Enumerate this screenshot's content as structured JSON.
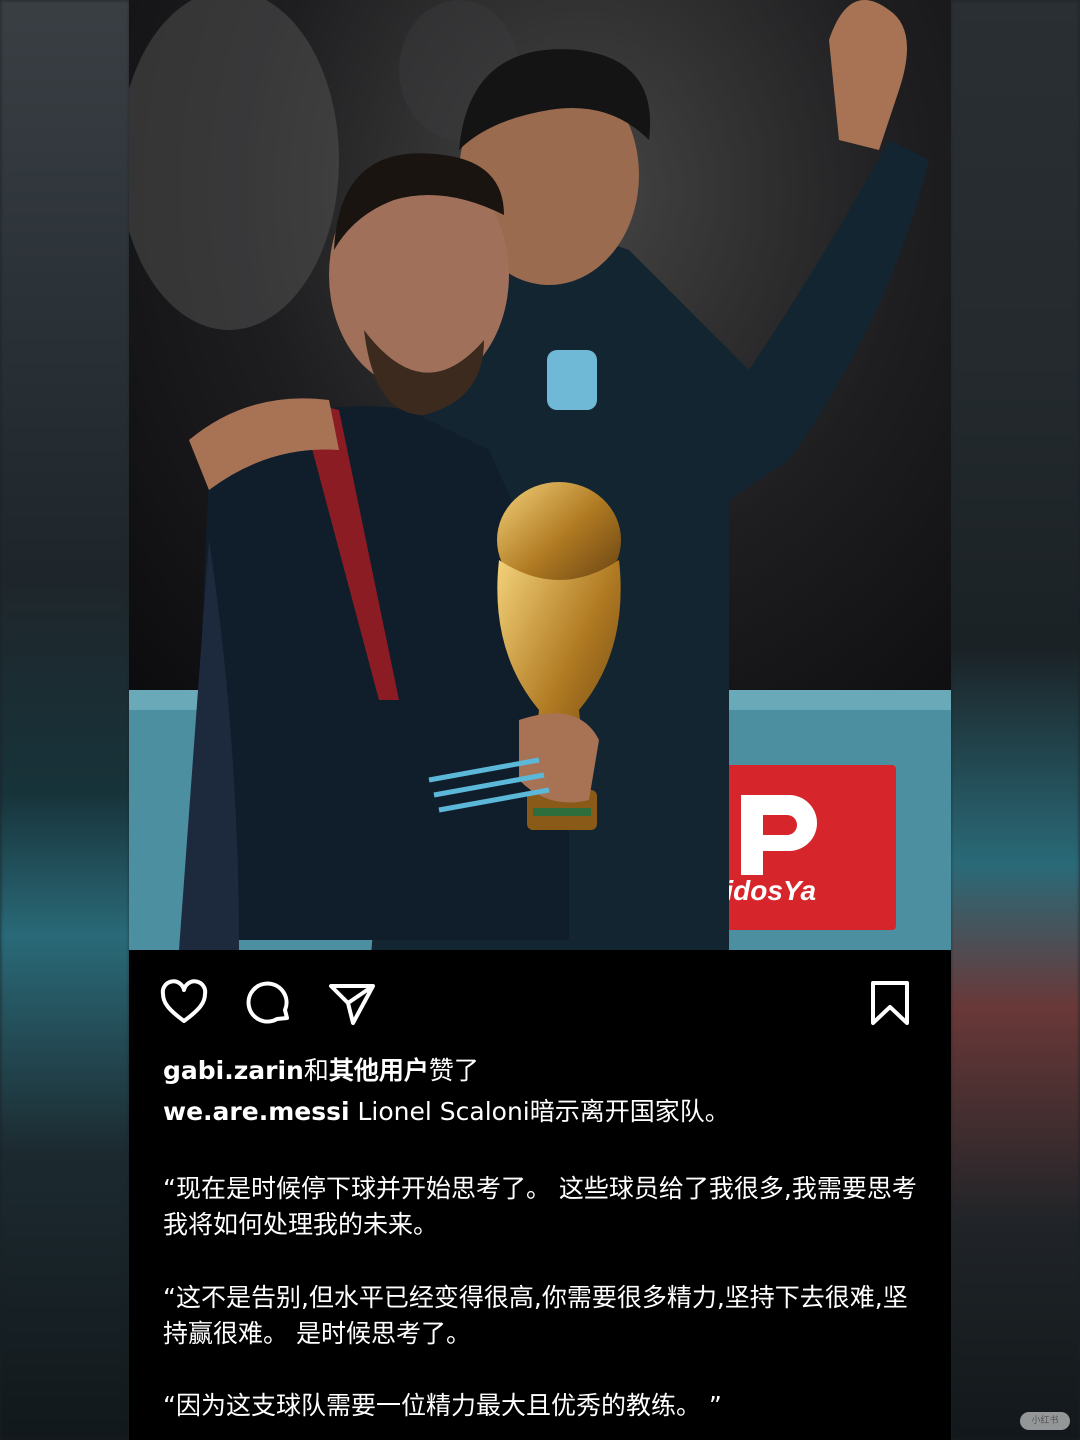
{
  "post": {
    "likes": {
      "user": "gabi.zarin",
      "connector": "和",
      "others": "其他用户",
      "suffix": "赞了"
    },
    "caption": {
      "username": "we.are.messi",
      "text": "Lionel Scaloni暗示离开国家队。"
    },
    "quotes": [
      "“现在是时候停下球并开始思考了。 这些球员给了我很多,我需要思考我将如何处理我的未来。",
      "“这不是告别,但水平已经变得很高,你需要很多精力,坚持下去很难,坚持赢很难。 是时候思考了。",
      "“因为这支球队需要一位精力最大且优秀的教练。 ”"
    ],
    "photo": {
      "sponsor_text": "PedidosYa",
      "sponsor_color": "#d6262c"
    },
    "actions": {
      "like_icon": "heart-icon",
      "comment_icon": "comment-icon",
      "share_icon": "send-icon",
      "save_icon": "bookmark-icon"
    }
  },
  "watermark": "小红书"
}
